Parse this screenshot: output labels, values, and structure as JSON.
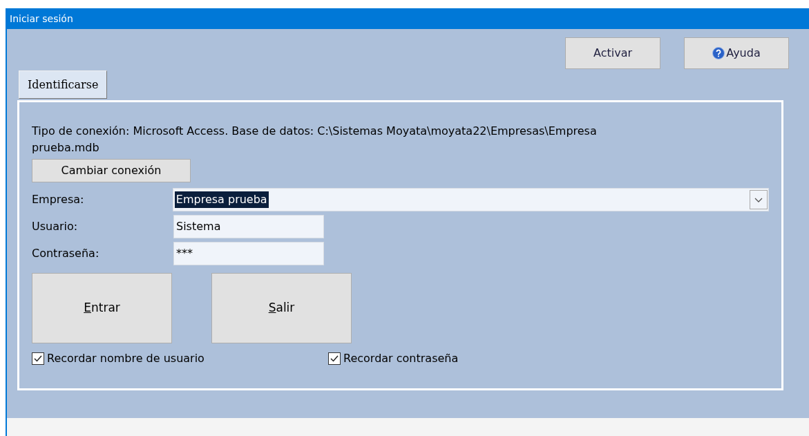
{
  "window": {
    "title": "Iniciar sesión"
  },
  "top_buttons": [
    {
      "label": "Activar",
      "kind": "plain"
    },
    {
      "label": "Ayuda",
      "kind": "help"
    }
  ],
  "tabs": [
    {
      "label": "Identificarse",
      "selected": true
    }
  ],
  "connection_info": "Tipo de conexión: Microsoft Access. Base de datos: C:\\Sistemas Moyata\\moyata22\\Empresas\\Empresa prueba.mdb",
  "change_connection_button": "Cambiar conexión",
  "fields": [
    {
      "label": "Empresa:",
      "value": "Empresa prueba",
      "kind": "dropdown",
      "selected": true
    },
    {
      "label": "Usuario:",
      "value": "Sistema",
      "kind": "text",
      "selected": false
    },
    {
      "label": "Contraseña:",
      "value": "***",
      "kind": "text",
      "selected": false
    }
  ],
  "action_buttons": [
    {
      "label": "Entrar",
      "mnemonic_first": true
    },
    {
      "label": "Salir",
      "mnemonic_first": true
    }
  ],
  "checkboxes": [
    {
      "label": "Recordar nombre de usuario",
      "checked": true
    },
    {
      "label": "Recordar contraseña",
      "checked": true
    }
  ]
}
